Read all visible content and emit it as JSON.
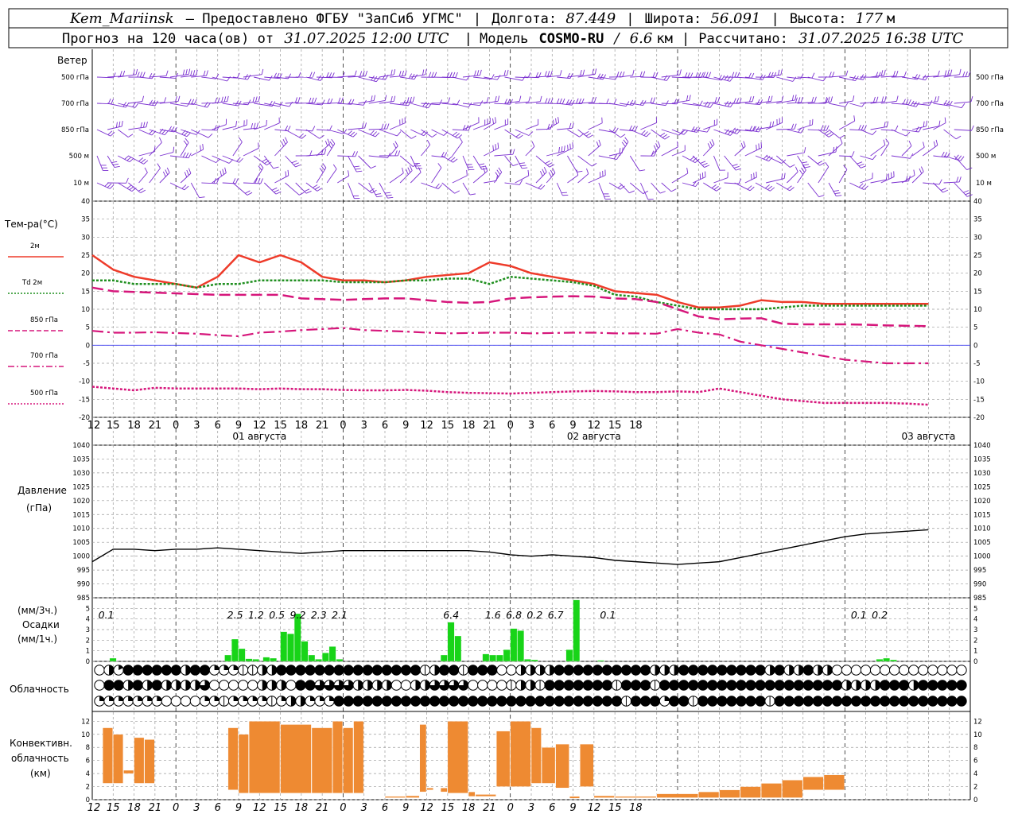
{
  "header": {
    "station": "Kem_Mariinsk",
    "provider": "– Предоставлено ФГБУ \"ЗапСиб УГМС\"",
    "lon_label": "Долгота:",
    "lon_value": "87.449",
    "lat_label": "Широта:",
    "lat_value": "56.091",
    "alt_label": "Высота:",
    "alt_value": "177",
    "alt_unit": "м",
    "forecast_prefix": "Прогноз на 120 часа(ов) от",
    "forecast_time": "31.07.2025 12:00 UTC",
    "model_label": "Модель",
    "model_name": "COSMO-RU",
    "model_res": "6.6",
    "model_res_unit": "км",
    "computed_label": "Рассчитано:",
    "computed_time": "31.07.2025 16:38 UTC"
  },
  "chart_data": [
    {
      "type": "wind-barbs",
      "title": "Ветер",
      "levels": [
        "500 гПа",
        "700 гПа",
        "850 гПа",
        "500 м",
        "10 м"
      ],
      "color": "#7a2fd0"
    },
    {
      "type": "line",
      "ylabel": "Тем-ра(°C)",
      "ylim": [
        -20,
        40
      ],
      "yticks": [
        -20,
        -15,
        -10,
        -5,
        0,
        5,
        10,
        15,
        20,
        25,
        30,
        35,
        40
      ],
      "x_hours": [
        0,
        3,
        6,
        9,
        12,
        15,
        18,
        21,
        24,
        27,
        30,
        33,
        36,
        39,
        42,
        45,
        48,
        51,
        54,
        57,
        60,
        63,
        66,
        69,
        72,
        75,
        78,
        81,
        84,
        87,
        90,
        93,
        96,
        99,
        102,
        105,
        108,
        111,
        114,
        117,
        120
      ],
      "series": [
        {
          "name": "2м",
          "color": "#ee3b2a",
          "style": "solid",
          "values": [
            25,
            21,
            19,
            18,
            17,
            16,
            19,
            25,
            23,
            25,
            23,
            19,
            18,
            18,
            17.5,
            18,
            19,
            19.5,
            20,
            23,
            22,
            20,
            19,
            18,
            17,
            15,
            14.5,
            14,
            12,
            10.5,
            10.5,
            11,
            12.5,
            12,
            12,
            11.5,
            11.5,
            11.5,
            11.5,
            11.5,
            11.5
          ]
        },
        {
          "name": "Td 2м",
          "color": "#1f8f1f",
          "style": "dotted",
          "values": [
            18,
            18,
            17,
            17,
            17,
            16,
            17,
            17,
            18,
            18,
            18,
            18,
            17.5,
            17.5,
            17.5,
            18,
            18,
            18.5,
            18.5,
            17,
            19,
            18.5,
            18,
            17.5,
            16.5,
            14,
            13.5,
            12,
            11,
            10,
            10,
            10,
            10,
            10.5,
            11,
            11,
            11,
            11,
            11,
            11,
            11
          ]
        },
        {
          "name": "850 гПа",
          "color": "#d6167b",
          "style": "dashed",
          "values": [
            16,
            15,
            14.8,
            14.6,
            14.4,
            14.2,
            14,
            14,
            14,
            14,
            13,
            12.8,
            12.6,
            12.8,
            13,
            13,
            12.5,
            12,
            11.8,
            12,
            13,
            13.3,
            13.5,
            13.6,
            13.5,
            13,
            12.8,
            12,
            10,
            8,
            7.2,
            7.4,
            7.5,
            6,
            5.8,
            5.8,
            5.8,
            5.7,
            5.5,
            5.4,
            5.3
          ]
        },
        {
          "name": "700 гПа",
          "color": "#d6167b",
          "style": "dashdot",
          "values": [
            4,
            3.5,
            3.5,
            3.6,
            3.4,
            3.2,
            2.8,
            2.5,
            3.5,
            3.8,
            4.2,
            4.5,
            4.8,
            4.2,
            4,
            3.8,
            3.5,
            3.3,
            3.4,
            3.5,
            3.5,
            3.3,
            3.4,
            3.5,
            3.5,
            3.3,
            3.3,
            3.2,
            4.5,
            3.5,
            3,
            1,
            0,
            -1,
            -2,
            -3,
            -4,
            -4.5,
            -5,
            -5,
            -5
          ]
        },
        {
          "name": "500 гПа",
          "color": "#d6167b",
          "style": "dotted",
          "values": [
            -11.5,
            -12,
            -12.5,
            -11.8,
            -12,
            -12,
            -12,
            -12,
            -12.2,
            -12,
            -12.2,
            -12.2,
            -12.4,
            -12.5,
            -12.5,
            -12.4,
            -12.6,
            -13,
            -13.2,
            -13.3,
            -13.4,
            -13.2,
            -13,
            -12.8,
            -12.7,
            -12.8,
            -13,
            -13,
            -12.8,
            -13,
            -12,
            -13,
            -14,
            -15,
            -15.5,
            -16,
            -16,
            -16,
            -16,
            -16.2,
            -16.5
          ]
        }
      ],
      "zero_line_color": "#3a3af0"
    },
    {
      "type": "line",
      "ylabel": "Давление",
      "ylabel2": "(гПа)",
      "ylim": [
        985,
        1040
      ],
      "yticks": [
        985,
        990,
        995,
        1000,
        1005,
        1010,
        1015,
        1020,
        1025,
        1030,
        1035,
        1040
      ],
      "x_hours": [
        0,
        3,
        6,
        9,
        12,
        15,
        18,
        21,
        24,
        27,
        30,
        33,
        36,
        39,
        42,
        45,
        48,
        51,
        54,
        57,
        60,
        63,
        66,
        69,
        72,
        75,
        78,
        81,
        84,
        87,
        90,
        93,
        96,
        99,
        102,
        105,
        108,
        111,
        114,
        117,
        120
      ],
      "series": [
        {
          "name": "Давление",
          "color": "#000000",
          "values": [
            998,
            1002.5,
            1002.5,
            1002,
            1002.5,
            1002.5,
            1003,
            1002.5,
            1002,
            1001.5,
            1001,
            1001.5,
            1002,
            1002,
            1002,
            1002,
            1002,
            1002,
            1002,
            1001.5,
            1000.5,
            1000,
            1000.5,
            1000,
            999.5,
            998.5,
            998,
            997.5,
            997,
            997.5,
            998,
            999.5,
            1001,
            1002.5,
            1004,
            1005.5,
            1007,
            1008,
            1008.5,
            1009,
            1009.5
          ]
        }
      ]
    },
    {
      "type": "bar",
      "ylabel": "Осадки",
      "ylabel_top": "(мм/3ч.)",
      "ylabel_bottom": "(мм/1ч.)",
      "ylim": [
        0,
        6
      ],
      "yticks": [
        0,
        1,
        2,
        3,
        4,
        5
      ],
      "color": "#18d418",
      "bars": [
        {
          "h": 3,
          "v": 0.3
        },
        {
          "h": 19.5,
          "v": 0.6
        },
        {
          "h": 20.5,
          "v": 2.1
        },
        {
          "h": 21.5,
          "v": 1.2
        },
        {
          "h": 22.5,
          "v": 0.25
        },
        {
          "h": 23.5,
          "v": 0.2
        },
        {
          "h": 25,
          "v": 0.4
        },
        {
          "h": 26,
          "v": 0.3
        },
        {
          "h": 27.5,
          "v": 2.8
        },
        {
          "h": 28.5,
          "v": 2.6
        },
        {
          "h": 29.5,
          "v": 4.5
        },
        {
          "h": 30.5,
          "v": 1.9
        },
        {
          "h": 31.5,
          "v": 0.6
        },
        {
          "h": 32.5,
          "v": 0.2
        },
        {
          "h": 33.5,
          "v": 0.8
        },
        {
          "h": 34.5,
          "v": 1.4
        },
        {
          "h": 35.5,
          "v": 0.2
        },
        {
          "h": 50.5,
          "v": 0.6
        },
        {
          "h": 51.5,
          "v": 3.7
        },
        {
          "h": 52.5,
          "v": 2.4
        },
        {
          "h": 56.5,
          "v": 0.7
        },
        {
          "h": 57.5,
          "v": 0.6
        },
        {
          "h": 58.5,
          "v": 0.6
        },
        {
          "h": 59.5,
          "v": 1.1
        },
        {
          "h": 60.5,
          "v": 3.1
        },
        {
          "h": 61.5,
          "v": 2.9
        },
        {
          "h": 62.5,
          "v": 0.2
        },
        {
          "h": 63.5,
          "v": 0.15
        },
        {
          "h": 68.5,
          "v": 1.1
        },
        {
          "h": 69.5,
          "v": 5.8
        },
        {
          "h": 73,
          "v": 0.1
        },
        {
          "h": 113,
          "v": 0.2
        },
        {
          "h": 114,
          "v": 0.3
        },
        {
          "h": 115,
          "v": 0.15
        }
      ],
      "labels": [
        {
          "h": 2,
          "text": "0.1"
        },
        {
          "h": 20.5,
          "text": "2.5"
        },
        {
          "h": 23.5,
          "text": "1.2"
        },
        {
          "h": 26.5,
          "text": "0.5"
        },
        {
          "h": 29.5,
          "text": "9.2"
        },
        {
          "h": 32.5,
          "text": "2.3"
        },
        {
          "h": 35.5,
          "text": "2.1"
        },
        {
          "h": 51.5,
          "text": "6.4"
        },
        {
          "h": 57.5,
          "text": "1.6"
        },
        {
          "h": 60.5,
          "text": "6.8"
        },
        {
          "h": 63.5,
          "text": "0.2"
        },
        {
          "h": 66.5,
          "text": "6.7"
        },
        {
          "h": 74,
          "text": "0.1"
        },
        {
          "h": 110,
          "text": "0.1"
        },
        {
          "h": 113,
          "text": "0.2"
        }
      ]
    },
    {
      "type": "table",
      "ylabel": "Облачность",
      "rows": [
        "ohsddddddhddqqqffhhdddddddddddddddfhddfdddoohhhhddddddddddhhhdddddddddhdhhdhhoooooooooooooo",
        "oddhdhdhhhhtooooohhhoddtttthhhhoohhttttoooofhhfdddddddfdddfdddddddddddddddddddhhhhdddhdddddddddd",
        "qqqqqqqooooqqfqqqqfqhhqqqddddddddddddddddddddddddddddddfdddqddfdddddddfdddddddddddddddddddddddd"
      ]
    },
    {
      "type": "bar",
      "ylabel": "Конвективн.",
      "ylabel2": "облачность",
      "ylabel3": "(км)",
      "ylim": [
        0,
        13.5
      ],
      "yticks": [
        0,
        2,
        4,
        6,
        8,
        10,
        12
      ],
      "color": "#ee8a32",
      "bars": [
        {
          "h0": 1.5,
          "h1": 3,
          "lo": 2.5,
          "hi": 11
        },
        {
          "h0": 3,
          "h1": 4.5,
          "lo": 2.5,
          "hi": 10
        },
        {
          "h0": 4.5,
          "h1": 6,
          "lo": 4,
          "hi": 4.5
        },
        {
          "h0": 6,
          "h1": 7.5,
          "lo": 2.5,
          "hi": 9.5
        },
        {
          "h0": 7.5,
          "h1": 9,
          "lo": 2.5,
          "hi": 9.2
        },
        {
          "h0": 0.5,
          "h1": 1.5,
          "lo": 3.3,
          "hi": 4.5,
          "off": 1
        },
        {
          "h0": 19.5,
          "h1": 21,
          "lo": 1.5,
          "hi": 11
        },
        {
          "h0": 21,
          "h1": 22.5,
          "lo": 1,
          "hi": 10
        },
        {
          "h0": 22.5,
          "h1": 27,
          "lo": 1,
          "hi": 12
        },
        {
          "h0": 27,
          "h1": 31.5,
          "lo": 1,
          "hi": 11.5
        },
        {
          "h0": 31.5,
          "h1": 34.5,
          "lo": 1,
          "hi": 11
        },
        {
          "h0": 34.5,
          "h1": 36,
          "lo": 1,
          "hi": 12
        },
        {
          "h0": 36,
          "h1": 37.5,
          "lo": 1,
          "hi": 11
        },
        {
          "h0": 37.5,
          "h1": 39,
          "lo": 1,
          "hi": 12
        },
        {
          "h0": 42,
          "h1": 45,
          "lo": 0.3,
          "hi": 0.5
        },
        {
          "h0": 45,
          "h1": 47,
          "lo": 0.3,
          "hi": 0.6
        },
        {
          "h0": 47,
          "h1": 48,
          "lo": 1.2,
          "hi": 11.5
        },
        {
          "h0": 48,
          "h1": 49,
          "lo": 1.5,
          "hi": 1.8
        },
        {
          "h0": 50,
          "h1": 51,
          "lo": 1.2,
          "hi": 1.8
        },
        {
          "h0": 51,
          "h1": 54,
          "lo": 1,
          "hi": 12
        },
        {
          "h0": 54,
          "h1": 55,
          "lo": 0.5,
          "hi": 1.2
        },
        {
          "h0": 55,
          "h1": 58,
          "lo": 0.5,
          "hi": 0.8
        },
        {
          "h0": 58,
          "h1": 60,
          "lo": 2,
          "hi": 10.5
        },
        {
          "h0": 60,
          "h1": 63,
          "lo": 2,
          "hi": 12
        },
        {
          "h0": 63,
          "h1": 64.5,
          "lo": 2.5,
          "hi": 11
        },
        {
          "h0": 64.5,
          "h1": 66.5,
          "lo": 2.5,
          "hi": 8
        },
        {
          "h0": 66.5,
          "h1": 68.5,
          "lo": 1.8,
          "hi": 8.5
        },
        {
          "h0": 68.5,
          "h1": 70,
          "lo": 0.2,
          "hi": 0.5
        },
        {
          "h0": 70,
          "h1": 72,
          "lo": 2,
          "hi": 8.5
        },
        {
          "h0": 72,
          "h1": 75,
          "lo": 0.3,
          "hi": 0.6
        },
        {
          "h0": 75,
          "h1": 81,
          "lo": 0.3,
          "hi": 0.5
        },
        {
          "h0": 81,
          "h1": 87,
          "lo": 0.3,
          "hi": 0.9
        },
        {
          "h0": 87,
          "h1": 90,
          "lo": 0.3,
          "hi": 1.2
        },
        {
          "h0": 90,
          "h1": 93,
          "lo": 0.3,
          "hi": 1.5
        },
        {
          "h0": 93,
          "h1": 96,
          "lo": 0.3,
          "hi": 2
        },
        {
          "h0": 96,
          "h1": 99,
          "lo": 0.3,
          "hi": 2.5
        },
        {
          "h0": 99,
          "h1": 102,
          "lo": 0.3,
          "hi": 3
        },
        {
          "h0": 102,
          "h1": 105,
          "lo": 1.5,
          "hi": 3.5
        },
        {
          "h0": 105,
          "h1": 108,
          "lo": 1.5,
          "hi": 3.8
        }
      ]
    }
  ],
  "x_axis": {
    "hour_labels": [
      "12",
      "15",
      "18",
      "21",
      "0",
      "3",
      "6",
      "9",
      "12",
      "15",
      "18",
      "21",
      "0",
      "3",
      "6",
      "9",
      "12",
      "15",
      "18",
      "21",
      "0",
      "3",
      "6",
      "9",
      "12",
      "15",
      "18"
    ],
    "dates": [
      "01 августа",
      "02 августа",
      "03 августа"
    ]
  }
}
